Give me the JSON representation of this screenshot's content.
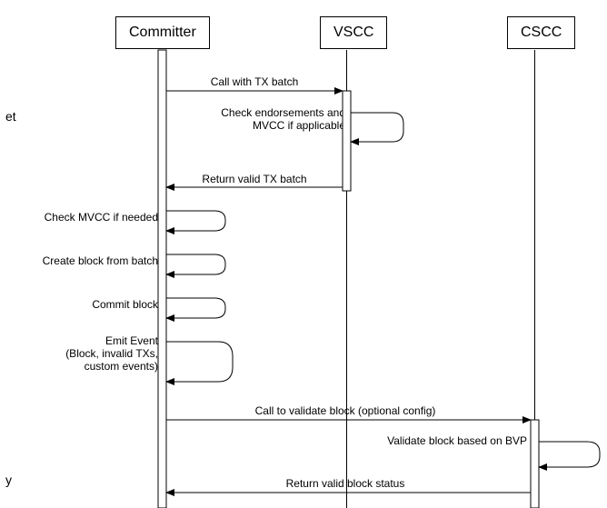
{
  "participants": {
    "committer": "Committer",
    "vscc": "VSCC",
    "cscc": "CSCC"
  },
  "messages": {
    "m1": "Call with TX batch",
    "m2": "Check endorsements and\nMVCC if applicable",
    "m3": "Return valid TX batch",
    "m4": "Check MVCC if needed",
    "m5": "Create block from batch",
    "m6": "Commit block",
    "m7": "Emit Event\n(Block, invalid TXs,\ncustom events)",
    "m8": "Call to validate block (optional config)",
    "m9": "Validate block based on BVP",
    "m10": "Return valid block status"
  },
  "fragments": {
    "left1": "et",
    "left2": "y"
  }
}
